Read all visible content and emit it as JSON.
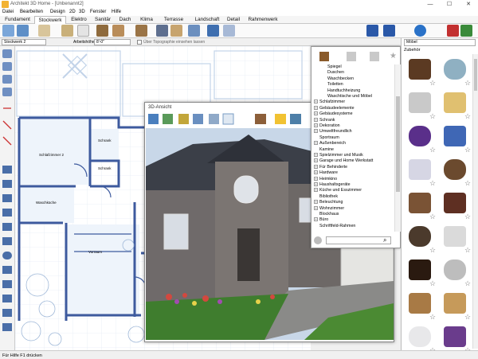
{
  "app": {
    "title": "Architekt 3D Home - [Unbenannt2]"
  },
  "window_controls": {
    "minimize": "—",
    "maximize": "☐",
    "close": "✕"
  },
  "menu": [
    "Datei",
    "Bearbeiten",
    "Design",
    "2D",
    "3D",
    "Fenster",
    "Hilfe"
  ],
  "tabs": [
    "Fundament",
    "Stockwerk",
    "Elektro",
    "Sanitär",
    "Dach",
    "Klima",
    "Terrasse",
    "Landschaft",
    "Detail",
    "Rahmenwerk"
  ],
  "active_tab": "Stockwerk",
  "options": {
    "floor_value": "Stockwerk 2",
    "workheight_label": "Arbeitshöhe",
    "workheight_value": "8'-0\"",
    "checkbox_label": "Über Topographie einsehen lassen"
  },
  "plan": {
    "rooms": [
      "Schlafzimmer 2",
      "Schrank",
      "Schrank",
      "Waschküche",
      "Vorraum"
    ]
  },
  "view3d": {
    "title": "3D-Ansicht"
  },
  "catalog": {
    "items": [
      {
        "label": "Spiegel",
        "level": 2,
        "expandable": false
      },
      {
        "label": "Duschen",
        "level": 2,
        "expandable": false
      },
      {
        "label": "Waschbecken",
        "level": 2,
        "expandable": false
      },
      {
        "label": "Toiletten",
        "level": 2,
        "expandable": false
      },
      {
        "label": "Handtuchheizung",
        "level": 2,
        "expandable": false
      },
      {
        "label": "Waschtische und Möbel",
        "level": 2,
        "expandable": false
      },
      {
        "label": "Schlafzimmer",
        "level": 1,
        "expandable": true
      },
      {
        "label": "Gebäudeelemente",
        "level": 1,
        "expandable": true
      },
      {
        "label": "Gebäudesysteme",
        "level": 1,
        "expandable": true
      },
      {
        "label": "Schrank",
        "level": 1,
        "expandable": true
      },
      {
        "label": "Dekoration",
        "level": 1,
        "expandable": true
      },
      {
        "label": "Umweltfreundlich",
        "level": 1,
        "expandable": true
      },
      {
        "label": "Sportraum",
        "level": 1,
        "expandable": false
      },
      {
        "label": "Außenbereich",
        "level": 1,
        "expandable": true
      },
      {
        "label": "Kamine",
        "level": 1,
        "expandable": false
      },
      {
        "label": "Spielzimmer und Musik",
        "level": 1,
        "expandable": true
      },
      {
        "label": "Garage und Home Werkstatt",
        "level": 1,
        "expandable": true
      },
      {
        "label": "Für Behinderte",
        "level": 1,
        "expandable": true
      },
      {
        "label": "Hardware",
        "level": 1,
        "expandable": true
      },
      {
        "label": "Heimkino",
        "level": 1,
        "expandable": true
      },
      {
        "label": "Haushaltsgeräte",
        "level": 1,
        "expandable": true
      },
      {
        "label": "Küche und Esszimmer",
        "level": 1,
        "expandable": true
      },
      {
        "label": "Bibliothek",
        "level": 1,
        "expandable": false
      },
      {
        "label": "Beleuchtung",
        "level": 1,
        "expandable": true
      },
      {
        "label": "Wohnzimmer",
        "level": 1,
        "expandable": true
      },
      {
        "label": "Blockhaus",
        "level": 1,
        "expandable": false
      },
      {
        "label": "Büro",
        "level": 1,
        "expandable": true
      },
      {
        "label": "Schriftfeld-Rahmen",
        "level": 1,
        "expandable": false
      }
    ]
  },
  "right_panel": {
    "select_value": "Möbel",
    "section_label": "Zubehör",
    "thumbnails": [
      {
        "name": "bowl",
        "color": "#5b3a22"
      },
      {
        "name": "jar",
        "color": "#8fb0c2"
      },
      {
        "name": "bottles",
        "color": "#c9c9c9"
      },
      {
        "name": "candles",
        "color": "#e0c070"
      },
      {
        "name": "bathmat-purple",
        "color": "#5a2f8a"
      },
      {
        "name": "vase-blue",
        "color": "#3f67b5"
      },
      {
        "name": "soap-dispenser",
        "color": "#d6d6e4"
      },
      {
        "name": "towel-brown",
        "color": "#6b4a2e"
      },
      {
        "name": "rug-brown",
        "color": "#7a5335"
      },
      {
        "name": "rug-ornament",
        "color": "#5e2f22"
      },
      {
        "name": "tray",
        "color": "#4b3a2c"
      },
      {
        "name": "towels-white",
        "color": "#dadada"
      },
      {
        "name": "basket",
        "color": "#2a1a10"
      },
      {
        "name": "toilet-brush",
        "color": "#bdbdbd"
      },
      {
        "name": "duckboard",
        "color": "#a87a45"
      },
      {
        "name": "stool",
        "color": "#c69a5a"
      },
      {
        "name": "washcloth",
        "color": "#e8e8ea"
      },
      {
        "name": "bottle-purple",
        "color": "#6a3c8c"
      }
    ]
  },
  "status": {
    "text": "Für Hilfe F1 drücken"
  },
  "colors": {
    "wall": "#3d5a9e",
    "plan_grid": "#c8d8ea",
    "accent": "#1e5fb3"
  }
}
